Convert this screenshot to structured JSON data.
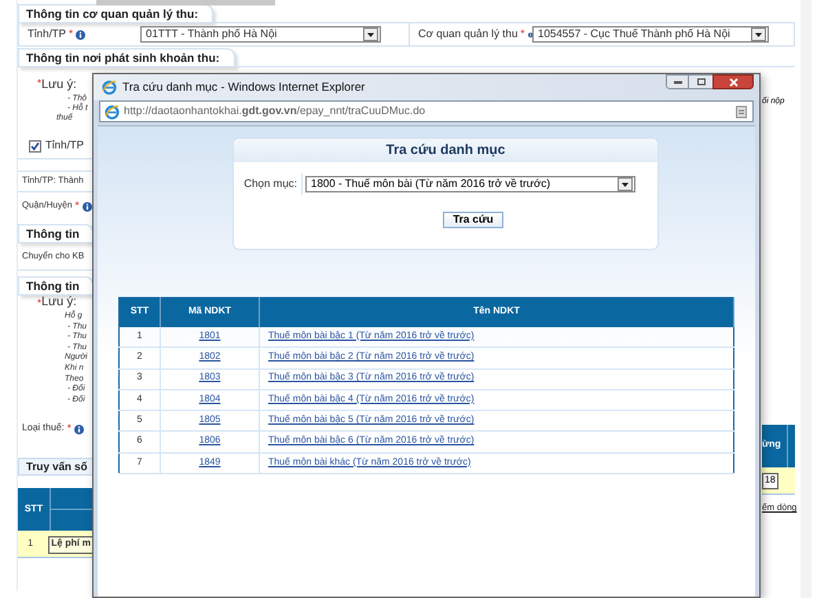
{
  "agency_section": {
    "title": "Thông tin cơ quan quản lý thu:",
    "province_label": "Tỉnh/TP",
    "province_required": "*",
    "province_value": "01TTT - Thành phố Hà Nội",
    "agency_label": "Cơ quan quản lý thu",
    "agency_required": "*",
    "agency_value": "1054557 - Cục Thuế Thành phố Hà Nội"
  },
  "origin_section": {
    "title": "Thông tin nơi phát sinh khoản thu:",
    "note_marker": "*",
    "note_label": "Lưu ý:",
    "note_lines": [
      "- Thô",
      "- Hỗ t",
      "thuế"
    ],
    "note_tail": "ối nộp",
    "province_checkbox": {
      "label": "Tỉnh/TP",
      "checked": true
    },
    "province_text": "Tỉnh/TP: Thành",
    "district_label": "Quận/Huyện",
    "district_required": "*"
  },
  "treasury_section": {
    "title": "Thông tin",
    "transfer_label": "Chuyển cho KB"
  },
  "fee_section": {
    "title": "Thông tin",
    "note_marker": "*",
    "note_label": "Lưu ý:",
    "note_lines": [
      "Hỗ g",
      "- Thu",
      "- Thu",
      "- Thu",
      "Người",
      "Khi n",
      "Theo",
      "- Đối",
      "- Đối"
    ],
    "tax_type_label": "Loại thuế:",
    "tax_type_required": "*"
  },
  "query_section": {
    "title": "Truy vấn số",
    "columns": [
      "STT",
      "ừng"
    ],
    "rows": [
      {
        "stt": "1",
        "item": "Lệ phí m",
        "amount": "18"
      }
    ],
    "link": "ếm dòng"
  },
  "popup": {
    "title": "Tra cứu danh mục - Windows Internet Explorer",
    "url": "http://daotaonhantokhai.**gdt.gov.vn**/epay_nnt/traCuuDMuc.do",
    "panel_title": "Tra cứu danh mục",
    "category_label": "Chọn mục:",
    "category_value": "1800 - Thuế môn bài (Từ năm 2016 trở về trước)",
    "search_button": "Tra cứu",
    "columns": [
      "STT",
      "Mã NDKT",
      "Tên NDKT"
    ],
    "rows": [
      {
        "stt": "1",
        "code": "1801",
        "name": "Thuế môn bài bậc 1 (Từ năm 2016 trở về trước)"
      },
      {
        "stt": "2",
        "code": "1802",
        "name": "Thuế môn bài bậc 2 (Từ năm 2016 trở về trước)"
      },
      {
        "stt": "3",
        "code": "1803",
        "name": "Thuế môn bài bậc 3 (Từ năm 2016 trở về trước)"
      },
      {
        "stt": "4",
        "code": "1804",
        "name": "Thuế môn bài bậc 4 (Từ năm 2016 trở về trước)"
      },
      {
        "stt": "5",
        "code": "1805",
        "name": "Thuế môn bài bậc 5 (Từ năm 2016 trở về trước)"
      },
      {
        "stt": "6",
        "code": "1806",
        "name": "Thuế môn bài bậc 6 (Từ năm 2016 trở về trước)"
      },
      {
        "stt": "7",
        "code": "1849",
        "name": "Thuế môn bài khác (Từ năm 2016 trở về trước)"
      }
    ]
  }
}
